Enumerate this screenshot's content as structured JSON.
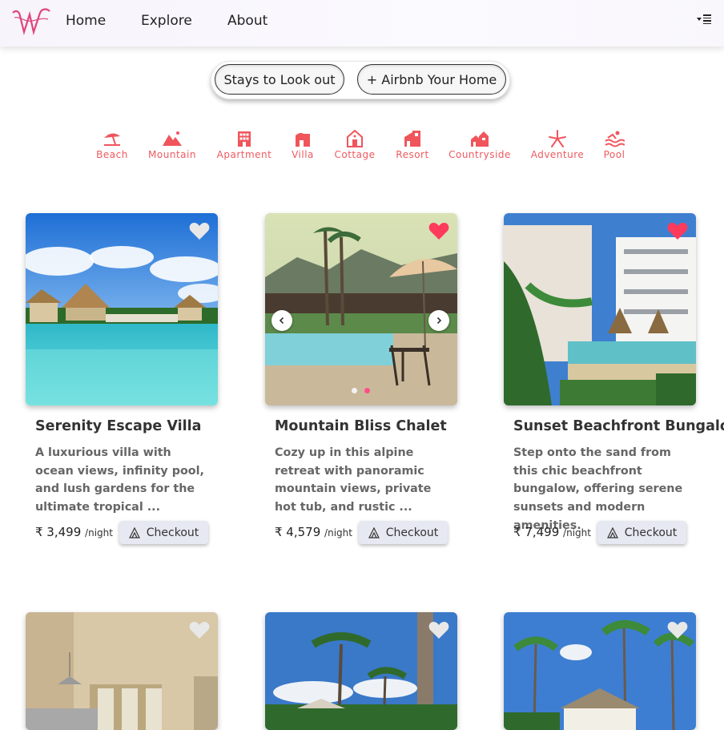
{
  "nav": {
    "links": [
      "Home",
      "Explore",
      "About"
    ]
  },
  "actions": {
    "stays_label": "Stays to Look out",
    "host_label": "+ Airbnb Your Home"
  },
  "categories": [
    {
      "label": "Beach",
      "icon": "umbrella-beach-icon"
    },
    {
      "label": "Mountain",
      "icon": "mountain-icon"
    },
    {
      "label": "Apartment",
      "icon": "building-icon"
    },
    {
      "label": "Villa",
      "icon": "villa-icon"
    },
    {
      "label": "Cottage",
      "icon": "cottage-icon"
    },
    {
      "label": "Resort",
      "icon": "resort-icon"
    },
    {
      "label": "Countryside",
      "icon": "countryside-icon"
    },
    {
      "label": "Adventure",
      "icon": "adventure-icon"
    },
    {
      "label": "Pool",
      "icon": "pool-icon"
    }
  ],
  "listings": [
    {
      "title": "Serenity Escape Villa",
      "description": "A luxurious villa with ocean views, infinity pool, and lush gardens for the ultimate tropical ...",
      "price": "₹ 3,499",
      "per": "/night",
      "checkout": "Checkout",
      "liked": false
    },
    {
      "title": "Mountain Bliss Chalet",
      "description": "Cozy up in this alpine retreat with panoramic mountain views, private hot tub, and rustic ...",
      "price": "₹ 4,579",
      "per": "/night",
      "checkout": "Checkout",
      "liked": true
    },
    {
      "title": "Sunset Beachfront Bungalo",
      "description": "Step onto the sand from this chic beachfront bungalow, offering serene sunsets and modern amenities.",
      "price": "₹ 7,499",
      "per": "/night",
      "checkout": "Checkout",
      "liked": true
    }
  ],
  "colors": {
    "accent": "#f0555c",
    "heart_liked": "#ff3b5c",
    "heart_unliked": "#e8e8e8"
  }
}
